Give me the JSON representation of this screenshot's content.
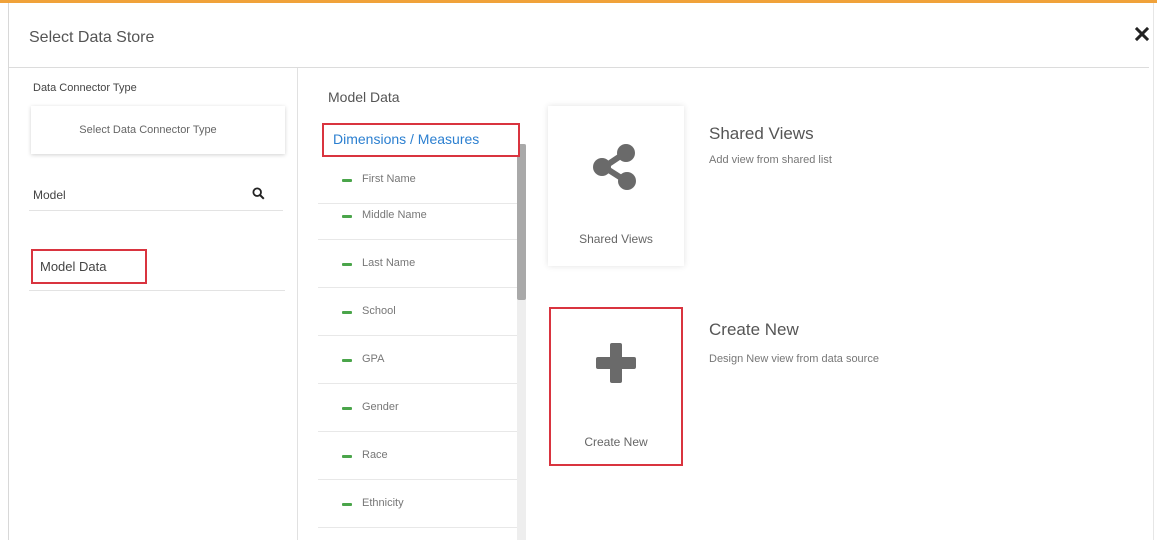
{
  "dialog": {
    "title": "Select Data Store",
    "close_icon": "close-x-icon"
  },
  "left_panel": {
    "connector_type_label": "Data Connector Type",
    "connector_type_placeholder": "Select Data Connector Type",
    "model_label": "Model",
    "search_icon": "search-icon",
    "model_items": [
      "Model Data"
    ]
  },
  "middle_panel": {
    "title": "Model Data",
    "dimensions_link": "Dimensions / Measures",
    "fields": [
      "First Name",
      "Middle Name",
      "Last Name",
      "School",
      "GPA",
      "Gender",
      "Race",
      "Ethnicity"
    ],
    "field_icon": "dimension-dash-icon",
    "field_icon_color": "#4aa54a"
  },
  "options": {
    "shared": {
      "card_label": "Shared Views",
      "title": "Shared Views",
      "description": "Add view from shared list",
      "icon": "share-icon"
    },
    "create": {
      "card_label": "Create New",
      "title": "Create New",
      "description": "Design New view from data source",
      "icon": "plus-icon"
    }
  },
  "colors": {
    "accent_top": "#f0a23a",
    "highlight_border": "#d9343f",
    "link_blue": "#2b7fd0"
  }
}
